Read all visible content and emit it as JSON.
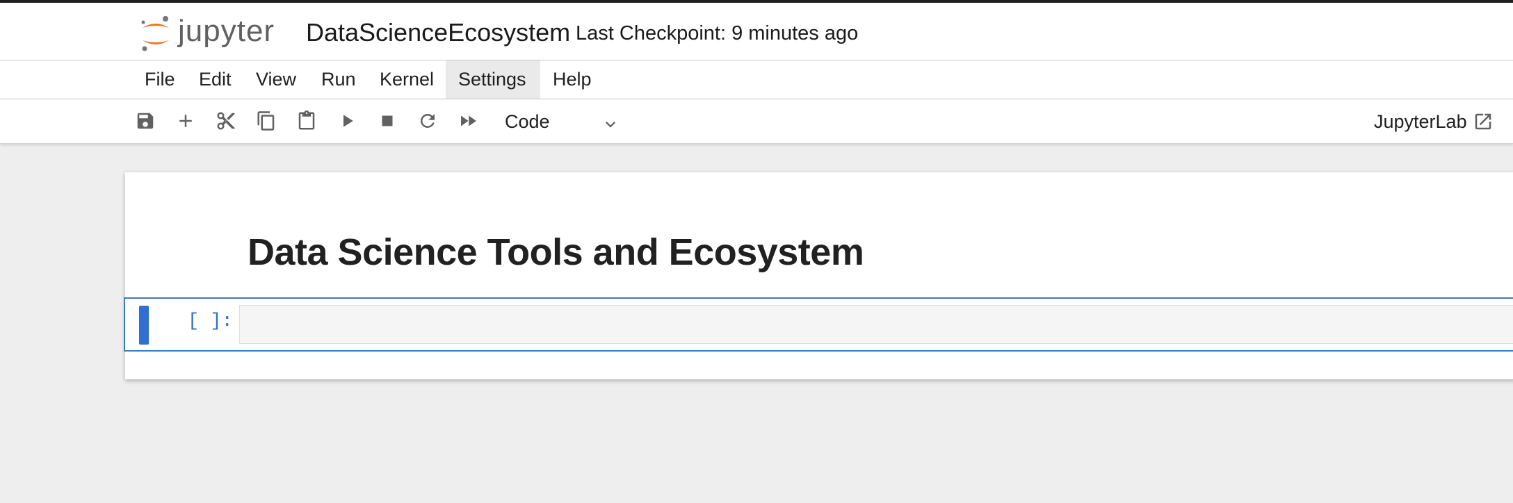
{
  "header": {
    "logo_text": "jupyter",
    "notebook_title": "DataScienceEcosystem",
    "checkpoint": "Last Checkpoint: 9 minutes ago"
  },
  "menubar": {
    "items": [
      {
        "label": "File"
      },
      {
        "label": "Edit"
      },
      {
        "label": "View"
      },
      {
        "label": "Run"
      },
      {
        "label": "Kernel"
      },
      {
        "label": "Settings",
        "active": true
      },
      {
        "label": "Help"
      }
    ]
  },
  "toolbar": {
    "buttons": [
      {
        "icon": "save-icon"
      },
      {
        "icon": "plus-icon"
      },
      {
        "icon": "scissors-icon"
      },
      {
        "icon": "copy-icon"
      },
      {
        "icon": "paste-icon"
      },
      {
        "icon": "run-icon"
      },
      {
        "icon": "stop-icon"
      },
      {
        "icon": "restart-icon"
      },
      {
        "icon": "fast-forward-icon"
      }
    ],
    "cell_type": "Code",
    "open_in_lab": "JupyterLab"
  },
  "notebook": {
    "markdown_heading": "Data Science Tools and Ecosystem",
    "code_cell_prompt": "[ ]:",
    "code_cell_content": ""
  },
  "colors": {
    "accent_blue": "#2f6fd1",
    "logo_orange": "#e8742c",
    "prompt_blue": "#3370c4"
  }
}
